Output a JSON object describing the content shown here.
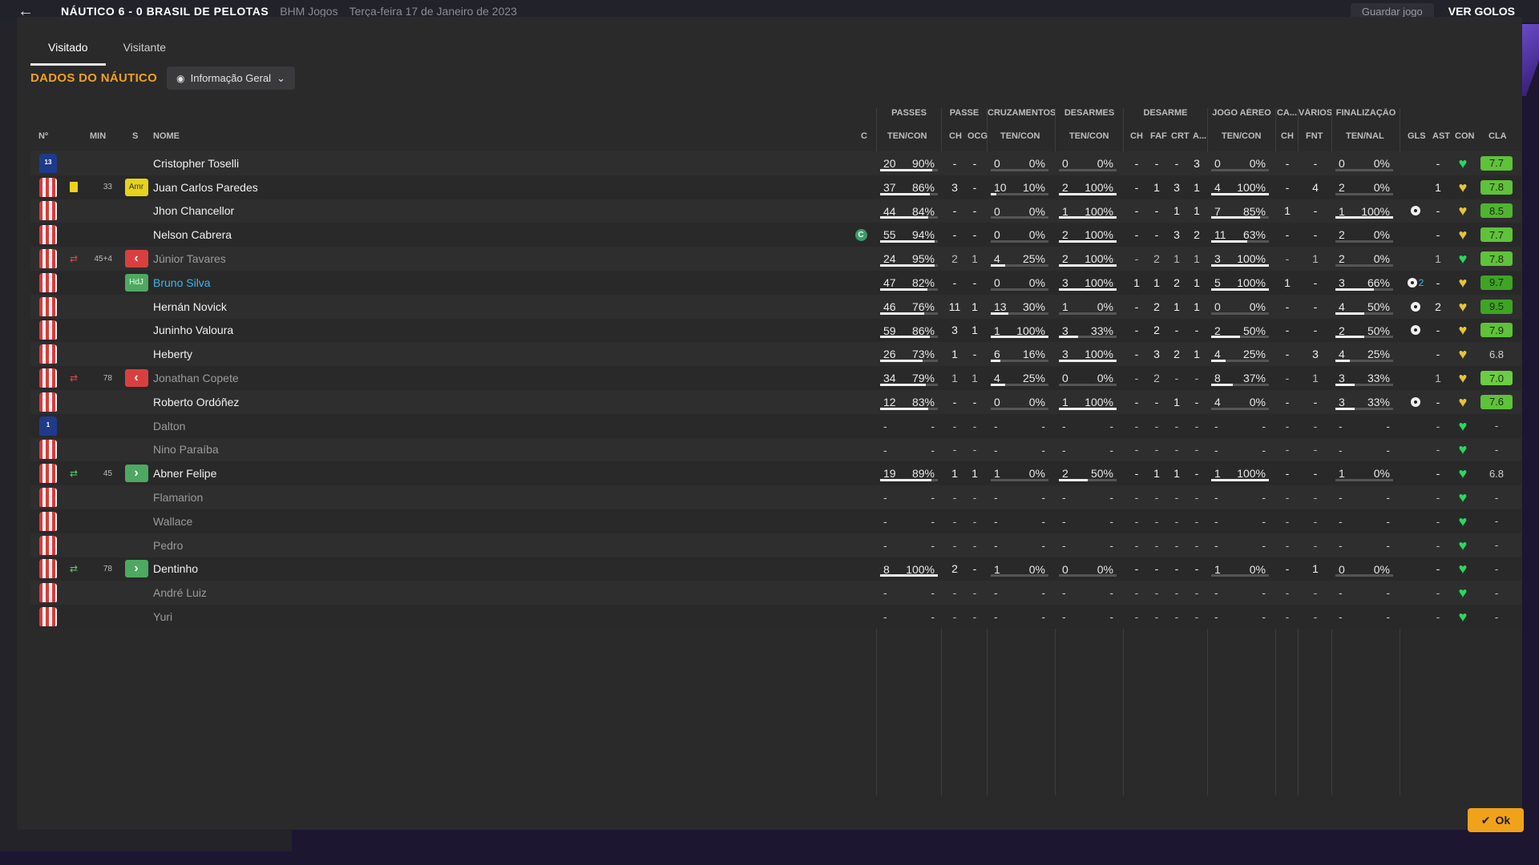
{
  "background": {
    "match_title": "NÁUTICO 6 - 0 BRASIL DE PELOTAS",
    "competition": "BHM Jogos",
    "date": "Terça-feira 17 de Janeiro de 2023",
    "save_button": "Guardar jogo",
    "goals_button": "VER GOLOS"
  },
  "tabs": [
    {
      "label": "Visitado"
    },
    {
      "label": "Visitante"
    }
  ],
  "section": {
    "title": "DADOS DO NÁUTICO",
    "view_select": "Informação Geral"
  },
  "groups": {
    "passes": "PASSES",
    "passe": "PASSE",
    "cruzamentos": "CRUZAMENTOS",
    "desarmes": "DESARMES",
    "desarme": "DESARME",
    "jogo_aereo": "JOGO AÉREO",
    "ca": "CA...",
    "varios": "VÁRIOS",
    "finalizacao": "FINALIZAÇÃO"
  },
  "headers": {
    "num": "Nº",
    "min": "MIN",
    "s": "S",
    "nome": "NOME",
    "c": "C",
    "passes_tc": "TEN/CON",
    "ch": "CH",
    "ocg": "OCG",
    "cruz_tc": "TEN/CON",
    "des_tc": "TEN/CON",
    "ch2": "CH",
    "faf": "FAF",
    "crt": "CRT",
    "a": "A...",
    "aer_tc": "TEN/CON",
    "ch3": "CH",
    "fnt": "FNT",
    "fin_tn": "TEN/NAL",
    "gls": "GLS",
    "ast": "AST",
    "con": "CON",
    "cla": "CLA"
  },
  "rows": [
    {
      "n": "13",
      "kit": "gk",
      "ev": "",
      "min": "",
      "pos": "",
      "name": "Cristopher Toselli",
      "cap": "",
      "active": true,
      "hl": false,
      "p": [
        "20",
        "90%"
      ],
      "pf": 0.9,
      "ch": "-",
      "ocg": "-",
      "cr": [
        "0",
        "0%"
      ],
      "crf": 0,
      "de": [
        "0",
        "0%"
      ],
      "def": 0,
      "dch": "-",
      "faf": "-",
      "crt": "-",
      "a": "3",
      "ae": [
        "0",
        "0%"
      ],
      "aef": 0,
      "ca": "-",
      "fnt": "-",
      "fi": [
        "0",
        "0%"
      ],
      "fif": 0,
      "gls": "",
      "ast": "-",
      "con": "g",
      "cla": "7.7",
      "clc": "#5fc23a"
    },
    {
      "n": "",
      "kit": "red",
      "ev": "yellow",
      "min": "33",
      "pos": "Amr",
      "name": "Juan Carlos Paredes",
      "cap": "",
      "active": true,
      "hl": false,
      "p": [
        "37",
        "86%"
      ],
      "pf": 0.86,
      "ch": "3",
      "ocg": "-",
      "cr": [
        "10",
        "10%"
      ],
      "crf": 0.1,
      "de": [
        "2",
        "100%"
      ],
      "def": 1,
      "dch": "-",
      "faf": "1",
      "crt": "3",
      "a": "1",
      "ae": [
        "4",
        "100%"
      ],
      "aef": 1,
      "ca": "-",
      "fnt": "4",
      "fi": [
        "2",
        "0%"
      ],
      "fif": 0,
      "gls": "",
      "ast": "1",
      "con": "y",
      "cla": "7.8",
      "clc": "#5fc23a"
    },
    {
      "n": "",
      "kit": "red",
      "ev": "",
      "min": "",
      "pos": "",
      "name": "Jhon Chancellor",
      "cap": "",
      "active": true,
      "hl": false,
      "p": [
        "44",
        "84%"
      ],
      "pf": 0.84,
      "ch": "-",
      "ocg": "-",
      "cr": [
        "0",
        "0%"
      ],
      "crf": 0,
      "de": [
        "1",
        "100%"
      ],
      "def": 1,
      "dch": "-",
      "faf": "-",
      "crt": "1",
      "a": "1",
      "ae": [
        "7",
        "85%"
      ],
      "aef": 0.85,
      "ca": "1",
      "fnt": "-",
      "fi": [
        "1",
        "100%"
      ],
      "fif": 1,
      "gls": "ball",
      "ast": "-",
      "con": "y",
      "cla": "8.5",
      "clc": "#4fb52e"
    },
    {
      "n": "",
      "kit": "red",
      "ev": "",
      "min": "",
      "pos": "",
      "name": "Nelson Cabrera",
      "cap": "C",
      "active": true,
      "hl": false,
      "p": [
        "55",
        "94%"
      ],
      "pf": 0.94,
      "ch": "-",
      "ocg": "-",
      "cr": [
        "0",
        "0%"
      ],
      "crf": 0,
      "de": [
        "2",
        "100%"
      ],
      "def": 1,
      "dch": "-",
      "faf": "-",
      "crt": "3",
      "a": "2",
      "ae": [
        "11",
        "63%"
      ],
      "aef": 0.63,
      "ca": "-",
      "fnt": "-",
      "fi": [
        "2",
        "0%"
      ],
      "fif": 0,
      "gls": "",
      "ast": "-",
      "con": "y",
      "cla": "7.7",
      "clc": "#5fc23a"
    },
    {
      "n": "",
      "kit": "red",
      "ev": "out",
      "min": "45+4",
      "pos": "out",
      "name": "Júnior Tavares",
      "cap": "",
      "active": false,
      "hl": false,
      "p": [
        "24",
        "95%"
      ],
      "pf": 0.95,
      "ch": "2",
      "ocg": "1",
      "cr": [
        "4",
        "25%"
      ],
      "crf": 0.25,
      "de": [
        "2",
        "100%"
      ],
      "def": 1,
      "dch": "-",
      "faf": "2",
      "crt": "1",
      "a": "1",
      "ae": [
        "3",
        "100%"
      ],
      "aef": 1,
      "ca": "-",
      "fnt": "1",
      "fi": [
        "2",
        "0%"
      ],
      "fif": 0,
      "gls": "",
      "ast": "1",
      "con": "g",
      "cla": "7.8",
      "clc": "#5fc23a"
    },
    {
      "n": "",
      "kit": "red",
      "ev": "",
      "min": "",
      "pos": "HdJ",
      "name": "Bruno Silva",
      "cap": "",
      "active": true,
      "hl": true,
      "p": [
        "47",
        "82%"
      ],
      "pf": 0.82,
      "ch": "-",
      "ocg": "-",
      "cr": [
        "0",
        "0%"
      ],
      "crf": 0,
      "de": [
        "3",
        "100%"
      ],
      "def": 1,
      "dch": "1",
      "faf": "1",
      "crt": "2",
      "a": "1",
      "ae": [
        "5",
        "100%"
      ],
      "aef": 1,
      "ca": "1",
      "fnt": "-",
      "fi": [
        "3",
        "66%"
      ],
      "fif": 0.66,
      "gls": "ball2",
      "ast": "-",
      "con": "y",
      "cla": "9.7",
      "clc": "#3fa424"
    },
    {
      "n": "",
      "kit": "red",
      "ev": "",
      "min": "",
      "pos": "",
      "name": "Hernán Novick",
      "cap": "",
      "active": true,
      "hl": false,
      "p": [
        "46",
        "76%"
      ],
      "pf": 0.76,
      "ch": "11",
      "ocg": "1",
      "cr": [
        "13",
        "30%"
      ],
      "crf": 0.3,
      "de": [
        "1",
        "0%"
      ],
      "def": 0,
      "dch": "-",
      "faf": "2",
      "crt": "1",
      "a": "1",
      "ae": [
        "0",
        "0%"
      ],
      "aef": 0,
      "ca": "-",
      "fnt": "-",
      "fi": [
        "4",
        "50%"
      ],
      "fif": 0.5,
      "gls": "ball",
      "ast": "2",
      "con": "y",
      "cla": "9.5",
      "clc": "#3fa424"
    },
    {
      "n": "",
      "kit": "red",
      "ev": "",
      "min": "",
      "pos": "",
      "name": "Juninho Valoura",
      "cap": "",
      "active": true,
      "hl": false,
      "p": [
        "59",
        "86%"
      ],
      "pf": 0.86,
      "ch": "3",
      "ocg": "1",
      "cr": [
        "1",
        "100%"
      ],
      "crf": 1,
      "de": [
        "3",
        "33%"
      ],
      "def": 0.33,
      "dch": "-",
      "faf": "2",
      "crt": "-",
      "a": "-",
      "ae": [
        "2",
        "50%"
      ],
      "aef": 0.5,
      "ca": "-",
      "fnt": "-",
      "fi": [
        "2",
        "50%"
      ],
      "fif": 0.5,
      "gls": "ball",
      "ast": "-",
      "con": "y",
      "cla": "7.9",
      "clc": "#5fc23a"
    },
    {
      "n": "",
      "kit": "red",
      "ev": "",
      "min": "",
      "pos": "",
      "name": "Heberty",
      "cap": "",
      "active": true,
      "hl": false,
      "p": [
        "26",
        "73%"
      ],
      "pf": 0.73,
      "ch": "1",
      "ocg": "-",
      "cr": [
        "6",
        "16%"
      ],
      "crf": 0.16,
      "de": [
        "3",
        "100%"
      ],
      "def": 1,
      "dch": "-",
      "faf": "3",
      "crt": "2",
      "a": "1",
      "ae": [
        "4",
        "25%"
      ],
      "aef": 0.25,
      "ca": "-",
      "fnt": "3",
      "fi": [
        "4",
        "25%"
      ],
      "fif": 0.25,
      "gls": "",
      "ast": "-",
      "con": "y",
      "cla": "6.8",
      "clc": ""
    },
    {
      "n": "",
      "kit": "red",
      "ev": "out",
      "min": "78",
      "pos": "out",
      "name": "Jonathan Copete",
      "cap": "",
      "active": false,
      "hl": false,
      "p": [
        "34",
        "79%"
      ],
      "pf": 0.79,
      "ch": "1",
      "ocg": "1",
      "cr": [
        "4",
        "25%"
      ],
      "crf": 0.25,
      "de": [
        "0",
        "0%"
      ],
      "def": 0,
      "dch": "-",
      "faf": "2",
      "crt": "-",
      "a": "-",
      "ae": [
        "8",
        "37%"
      ],
      "aef": 0.37,
      "ca": "-",
      "fnt": "1",
      "fi": [
        "3",
        "33%"
      ],
      "fif": 0.33,
      "gls": "",
      "ast": "1",
      "con": "y",
      "cla": "7.0",
      "clc": "#6ccc44"
    },
    {
      "n": "",
      "kit": "red",
      "ev": "",
      "min": "",
      "pos": "",
      "name": "Roberto Ordóñez",
      "cap": "",
      "active": true,
      "hl": false,
      "p": [
        "12",
        "83%"
      ],
      "pf": 0.83,
      "ch": "-",
      "ocg": "-",
      "cr": [
        "0",
        "0%"
      ],
      "crf": 0,
      "de": [
        "1",
        "100%"
      ],
      "def": 1,
      "dch": "-",
      "faf": "-",
      "crt": "1",
      "a": "-",
      "ae": [
        "4",
        "0%"
      ],
      "aef": 0,
      "ca": "-",
      "fnt": "-",
      "fi": [
        "3",
        "33%"
      ],
      "fif": 0.33,
      "gls": "ball",
      "ast": "-",
      "con": "y",
      "cla": "7.6",
      "clc": "#5fc23a"
    },
    {
      "n": "1",
      "kit": "gk",
      "ev": "",
      "min": "",
      "pos": "",
      "name": "Dalton",
      "cap": "",
      "active": false,
      "hl": false,
      "empty": true,
      "con": "g"
    },
    {
      "n": "",
      "kit": "red",
      "ev": "",
      "min": "",
      "pos": "",
      "name": "Nino Paraíba",
      "cap": "",
      "active": false,
      "hl": false,
      "empty": true,
      "con": "g"
    },
    {
      "n": "",
      "kit": "red",
      "ev": "in",
      "min": "45",
      "pos": "in",
      "name": "Abner Felipe",
      "cap": "",
      "active": true,
      "hl": false,
      "p": [
        "19",
        "89%"
      ],
      "pf": 0.89,
      "ch": "1",
      "ocg": "1",
      "cr": [
        "1",
        "0%"
      ],
      "crf": 0,
      "de": [
        "2",
        "50%"
      ],
      "def": 0.5,
      "dch": "-",
      "faf": "1",
      "crt": "1",
      "a": "-",
      "ae": [
        "1",
        "100%"
      ],
      "aef": 1,
      "ca": "-",
      "fnt": "-",
      "fi": [
        "1",
        "0%"
      ],
      "fif": 0,
      "gls": "",
      "ast": "-",
      "con": "g",
      "cla": "6.8",
      "clc": ""
    },
    {
      "n": "",
      "kit": "red",
      "ev": "",
      "min": "",
      "pos": "",
      "name": "Flamarion",
      "cap": "",
      "active": false,
      "hl": false,
      "empty": true,
      "con": "g"
    },
    {
      "n": "",
      "kit": "red",
      "ev": "",
      "min": "",
      "pos": "",
      "name": "Wallace",
      "cap": "",
      "active": false,
      "hl": false,
      "empty": true,
      "con": "g"
    },
    {
      "n": "",
      "kit": "red",
      "ev": "",
      "min": "",
      "pos": "",
      "name": "Pedro",
      "cap": "",
      "active": false,
      "hl": false,
      "empty": true,
      "con": "g"
    },
    {
      "n": "",
      "kit": "red",
      "ev": "in",
      "min": "78",
      "pos": "in",
      "name": "Dentinho",
      "cap": "",
      "active": true,
      "hl": false,
      "p": [
        "8",
        "100%"
      ],
      "pf": 1,
      "ch": "2",
      "ocg": "-",
      "cr": [
        "1",
        "0%"
      ],
      "crf": 0,
      "de": [
        "0",
        "0%"
      ],
      "def": 0,
      "dch": "-",
      "faf": "-",
      "crt": "-",
      "a": "-",
      "ae": [
        "1",
        "0%"
      ],
      "aef": 0,
      "ca": "-",
      "fnt": "1",
      "fi": [
        "0",
        "0%"
      ],
      "fif": 0,
      "gls": "",
      "ast": "-",
      "con": "g",
      "cla": "-",
      "clc": ""
    },
    {
      "n": "",
      "kit": "red",
      "ev": "",
      "min": "",
      "pos": "",
      "name": "André Luiz",
      "cap": "",
      "active": false,
      "hl": false,
      "empty": true,
      "con": "g"
    },
    {
      "n": "",
      "kit": "red",
      "ev": "",
      "min": "",
      "pos": "",
      "name": "Yuri",
      "cap": "",
      "active": false,
      "hl": false,
      "empty": true,
      "con": "g"
    }
  ],
  "ok_button": "Ok"
}
